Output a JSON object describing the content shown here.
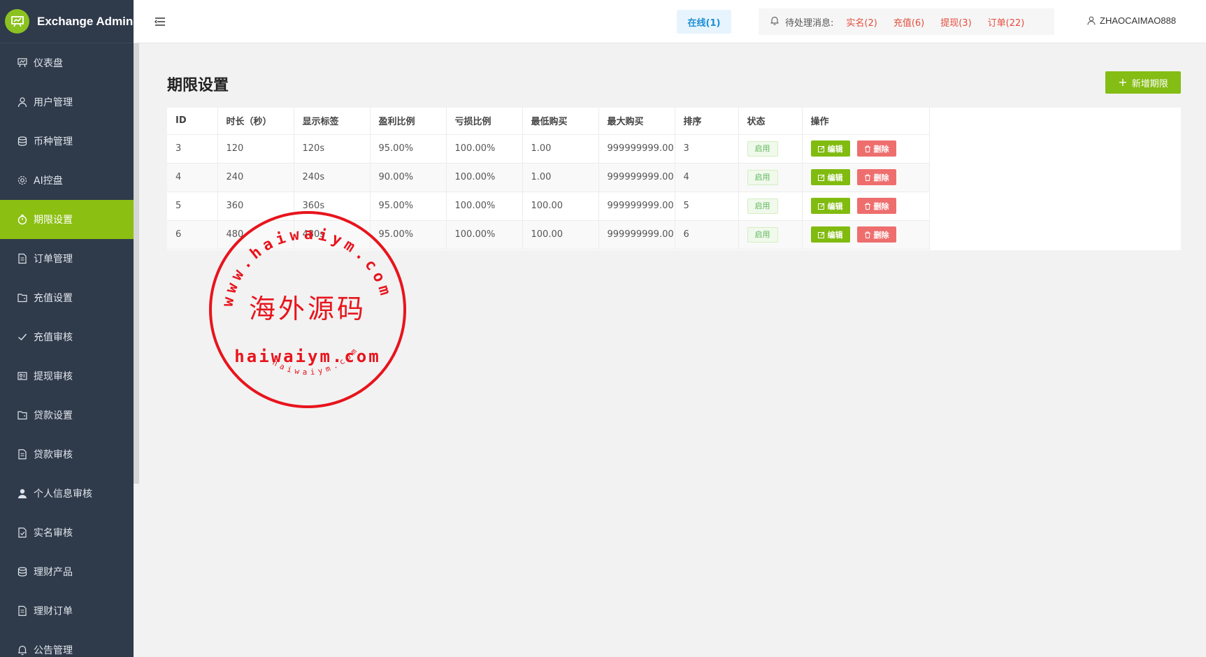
{
  "app": {
    "title": "Exchange Admin"
  },
  "sidebar": {
    "items": [
      {
        "label": "仪表盘",
        "icon": "dashboard-icon"
      },
      {
        "label": "用户管理",
        "icon": "user-icon"
      },
      {
        "label": "币种管理",
        "icon": "database-icon"
      },
      {
        "label": "AI控盘",
        "icon": "gear-icon"
      },
      {
        "label": "期限设置",
        "icon": "timer-icon",
        "active": true
      },
      {
        "label": "订单管理",
        "icon": "document-icon"
      },
      {
        "label": "充值设置",
        "icon": "folder-icon"
      },
      {
        "label": "充值审核",
        "icon": "check-icon"
      },
      {
        "label": "提现审核",
        "icon": "card-icon"
      },
      {
        "label": "贷款设置",
        "icon": "folder-icon"
      },
      {
        "label": "贷款审核",
        "icon": "document-icon"
      },
      {
        "label": "个人信息审核",
        "icon": "person-icon"
      },
      {
        "label": "实名审核",
        "icon": "verified-doc-icon"
      },
      {
        "label": "理财产品",
        "icon": "database-icon"
      },
      {
        "label": "理财订单",
        "icon": "document-icon"
      },
      {
        "label": "公告管理",
        "icon": "bell-icon"
      }
    ]
  },
  "header": {
    "online": "在线(1)",
    "notice_label": "待处理消息:",
    "notices": [
      "实名(2)",
      "充值(6)",
      "提现(3)",
      "订单(22)"
    ],
    "username": "ZHAOCAIMAO888"
  },
  "page": {
    "title": "期限设置",
    "add_button": "新增期限"
  },
  "table": {
    "headers": [
      "ID",
      "时长（秒）",
      "显示标签",
      "盈利比例",
      "亏损比例",
      "最低购买",
      "最大购买",
      "排序",
      "状态",
      "操作"
    ],
    "rows": [
      [
        "3",
        "120",
        "120s",
        "95.00%",
        "100.00%",
        "1.00",
        "999999999.00",
        "3",
        "启用"
      ],
      [
        "4",
        "240",
        "240s",
        "90.00%",
        "100.00%",
        "1.00",
        "999999999.00",
        "4",
        "启用"
      ],
      [
        "5",
        "360",
        "360s",
        "95.00%",
        "100.00%",
        "100.00",
        "999999999.00",
        "5",
        "启用"
      ],
      [
        "6",
        "480",
        "480s",
        "95.00%",
        "100.00%",
        "100.00",
        "999999999.00",
        "6",
        "启用"
      ]
    ],
    "edit_label": "编辑",
    "delete_label": "删除"
  },
  "watermark": {
    "arc_text": "www.haiwaiym.com",
    "center_text": "海外源码",
    "domain_text": "haiwaiym.com",
    "small_text": "haiwaiym.com"
  },
  "colors": {
    "sidebar_bg": "#2f3a4b",
    "accent": "#8bbf12",
    "danger": "#ee6e6e",
    "notice_link": "#e44c3c",
    "stamp_red": "#e8141c"
  }
}
